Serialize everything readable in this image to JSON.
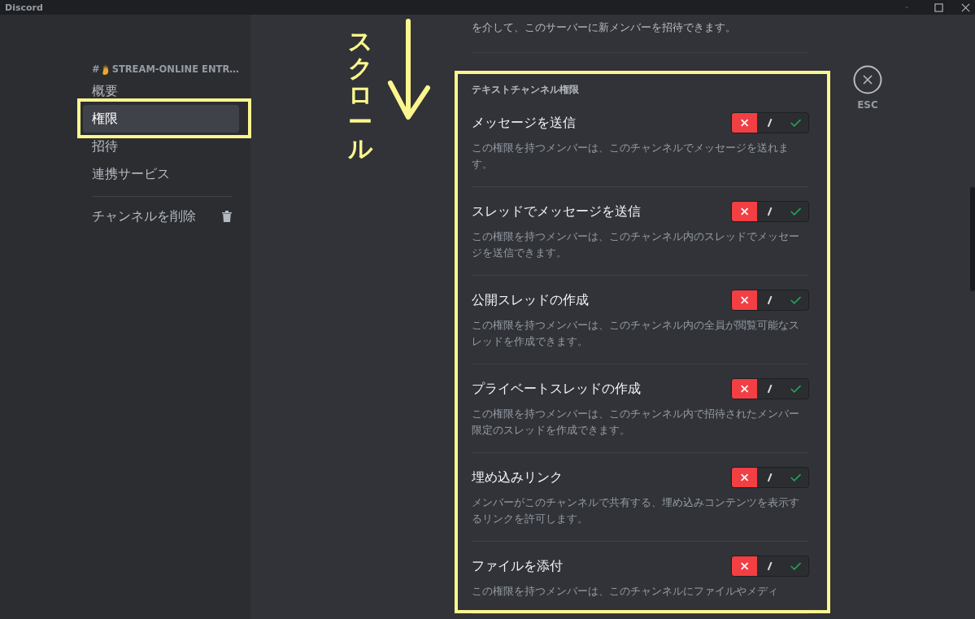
{
  "window": {
    "title": "Discord"
  },
  "sidebar": {
    "channel": {
      "hash": "#",
      "name": "STREAM-ONLINE ENTR…"
    },
    "items": [
      {
        "label": "概要",
        "selected": false
      },
      {
        "label": "権限",
        "selected": true
      },
      {
        "label": "招待",
        "selected": false
      },
      {
        "label": "連携サービス",
        "selected": false
      }
    ],
    "delete_label": "チャンネルを削除"
  },
  "content": {
    "top_text": "を介して、このサーバーに新メンバーを招待できます。",
    "section_title": "テキストチャンネル権限",
    "permissions": [
      {
        "title": "メッセージを送信",
        "description": "この権限を持つメンバーは、このチャンネルでメッセージを送れます。",
        "denied": true
      },
      {
        "title": "スレッドでメッセージを送信",
        "description": "この権限を持つメンバーは、このチャンネル内のスレッドでメッセージを送信できます。",
        "denied": true
      },
      {
        "title": "公開スレッドの作成",
        "description": "この権限を持つメンバーは、このチャンネル内の全員が閲覧可能なスレッドを作成できます。",
        "denied": true
      },
      {
        "title": "プライベートスレッドの作成",
        "description": "この権限を持つメンバーは、このチャンネル内で招待されたメンバー限定のスレッドを作成できます。",
        "denied": true
      },
      {
        "title": "埋め込みリンク",
        "description": "メンバーがこのチャンネルで共有する、埋め込みコンテンツを表示するリンクを許可します。",
        "denied": true
      },
      {
        "title": "ファイルを添付",
        "description": "この権限を持つメンバーは、このチャンネルにファイルやメディ",
        "denied": true
      }
    ]
  },
  "close": {
    "label": "ESC"
  },
  "annotation": {
    "text": "スクロール"
  }
}
